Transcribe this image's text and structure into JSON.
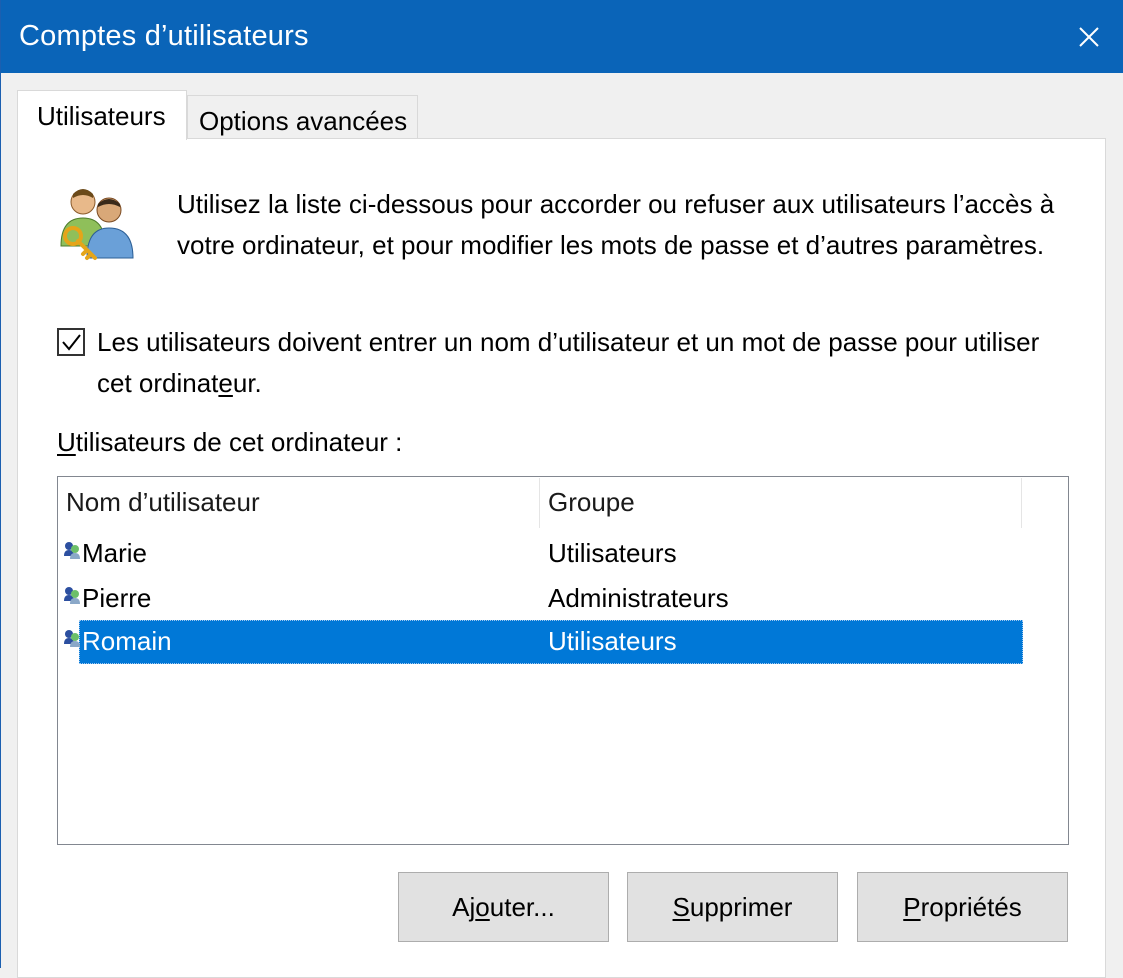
{
  "window": {
    "title": "Comptes d’utilisateurs",
    "close_icon": "close-icon"
  },
  "tabs": [
    {
      "label": "Utilisateurs",
      "active": true
    },
    {
      "label": "Options avancées",
      "active": false
    }
  ],
  "intro": {
    "icon": "users-key-icon",
    "text": "Utilisez la liste ci-dessous pour accorder ou refuser aux utilisateurs l’accès à votre ordinateur, et pour modifier les mots de passe et d’autres paramètres."
  },
  "require_login": {
    "checked": true,
    "label_before": "Les utilisateurs doivent entrer un nom d’utilisateur et un mot de passe pour utiliser cet ordinat",
    "label_mnemonic": "e",
    "label_after": "ur."
  },
  "users_list": {
    "label_mnemonic": "U",
    "label_rest": "tilisateurs de cet ordinateur :",
    "columns": [
      "Nom d’utilisateur",
      "Groupe"
    ],
    "rows": [
      {
        "name": "Marie",
        "group": "Utilisateurs",
        "selected": false
      },
      {
        "name": "Pierre",
        "group": "Administrateurs",
        "selected": false
      },
      {
        "name": "Romain",
        "group": "Utilisateurs",
        "selected": true
      }
    ]
  },
  "buttons": {
    "add": {
      "before": "Aj",
      "mnemonic": "o",
      "after": "uter..."
    },
    "remove": {
      "before": "",
      "mnemonic": "S",
      "after": "upprimer"
    },
    "properties": {
      "before": "",
      "mnemonic": "P",
      "after": "ropriétés"
    }
  },
  "colors": {
    "titlebar": "#0a64b8",
    "selection": "#0078d7"
  }
}
